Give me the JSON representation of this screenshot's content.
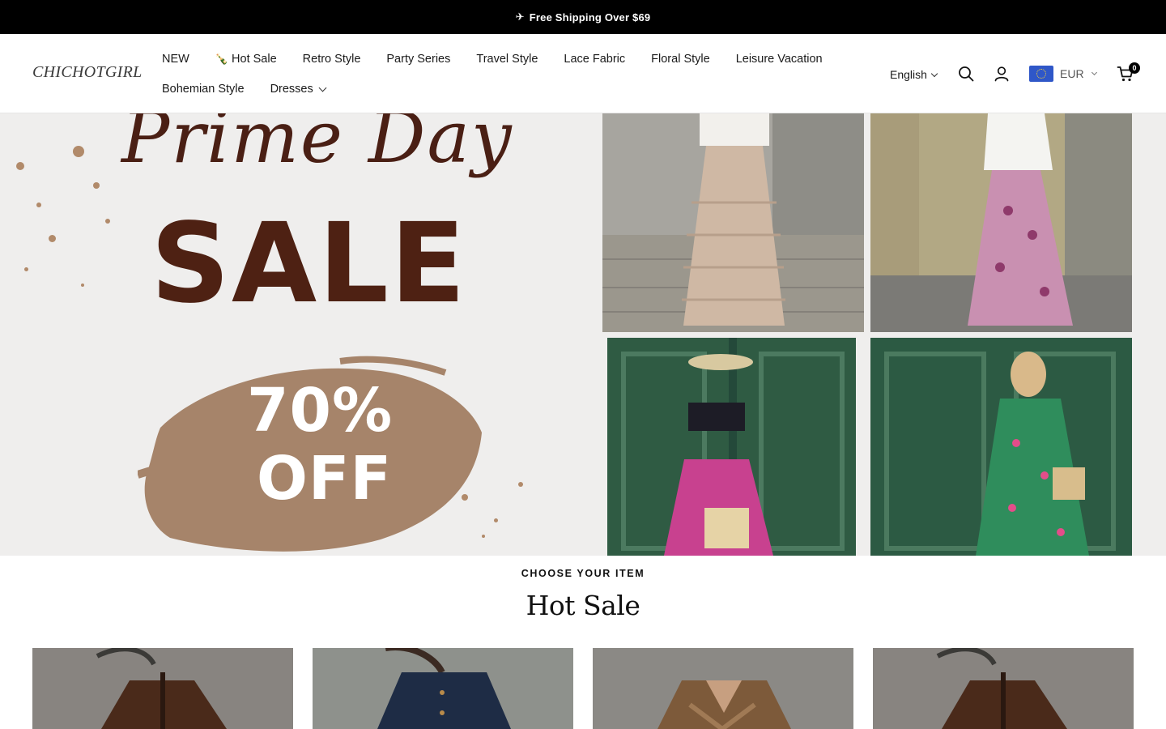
{
  "announcement": {
    "icon": "airplane-icon",
    "text": "Free Shipping Over $69"
  },
  "brand": {
    "logo_text": "CHICHOTGIRL"
  },
  "nav": {
    "row1": [
      "NEW",
      "Hot Sale",
      "Retro Style",
      "Party Series",
      "Travel Style",
      "Lace Fabric",
      "Floral Style",
      "Leisure Vacation"
    ],
    "row2": [
      "Bohemian Style",
      "Dresses"
    ],
    "hot_sale_icon": "bottle-icon"
  },
  "header_right": {
    "language": "English",
    "currency": "EUR",
    "cart_count": "0"
  },
  "hero": {
    "script_text": "Prime Day",
    "headline": "SALE",
    "discount_line1": "70%",
    "discount_line2": "OFF",
    "colors": {
      "headline": "#4e2113",
      "brush": "#a6846a"
    }
  },
  "section": {
    "eyebrow": "CHOOSE YOUR ITEM",
    "title": "Hot Sale"
  },
  "products": [
    {
      "image": "brown-suede-jacket"
    },
    {
      "image": "navy-denim-shirt"
    },
    {
      "image": "brown-suede-shirt"
    },
    {
      "image": "brown-suede-jacket"
    }
  ]
}
